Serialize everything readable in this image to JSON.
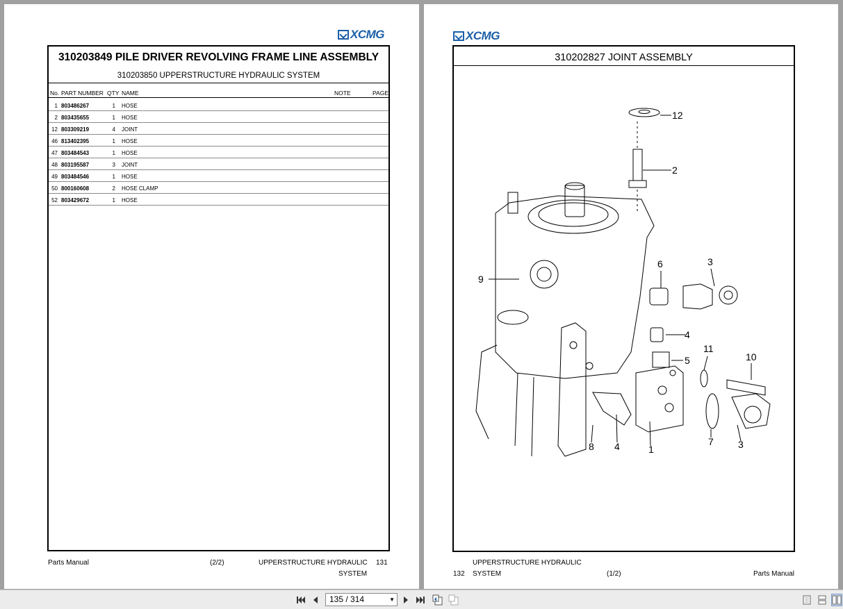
{
  "brand": "XCMG",
  "left_page": {
    "title": "310203849 PILE DRIVER REVOLVING FRAME LINE ASSEMBLY",
    "subtitle": "310203850 UPPERSTRUCTURE HYDRAULIC SYSTEM",
    "headers": {
      "no": "No.",
      "part_number": "PART NUMBER",
      "qty": "QTY",
      "name": "NAME",
      "note": "NOTE",
      "page": "PAGE"
    },
    "rows": [
      {
        "no": "1",
        "part_number": "803486267",
        "qty": "1",
        "name": "HOSE"
      },
      {
        "no": "2",
        "part_number": "803435655",
        "qty": "1",
        "name": "HOSE"
      },
      {
        "no": "12",
        "part_number": "803309219",
        "qty": "4",
        "name": "JOINT"
      },
      {
        "no": "46",
        "part_number": "813402395",
        "qty": "1",
        "name": "HOSE"
      },
      {
        "no": "47",
        "part_number": "803484543",
        "qty": "1",
        "name": "HOSE"
      },
      {
        "no": "48",
        "part_number": "803195587",
        "qty": "3",
        "name": "JOINT"
      },
      {
        "no": "49",
        "part_number": "803484546",
        "qty": "1",
        "name": "HOSE"
      },
      {
        "no": "50",
        "part_number": "800160608",
        "qty": "2",
        "name": "HOSE CLAMP"
      },
      {
        "no": "52",
        "part_number": "803429672",
        "qty": "1",
        "name": "HOSE"
      }
    ],
    "footer": {
      "manual": "Parts Manual",
      "part": "(2/2)",
      "section_line1": "UPPERSTRUCTURE HYDRAULIC",
      "section_line2": "SYSTEM",
      "page_number": "131"
    }
  },
  "right_page": {
    "title": "310202827 JOINT ASSEMBLY",
    "callouts": [
      "12",
      "2",
      "6",
      "3",
      "9",
      "4",
      "11",
      "10",
      "5",
      "7",
      "3",
      "8",
      "4",
      "1"
    ],
    "footer": {
      "page_number": "132",
      "section_line1": "UPPERSTRUCTURE HYDRAULIC",
      "section_line2": "SYSTEM",
      "part": "(1/2)",
      "manual": "Parts Manual"
    }
  },
  "toolbar": {
    "page_display": "135 / 314",
    "icons": [
      "first-page-icon",
      "prev-page-icon",
      "next-page-icon",
      "last-page-icon",
      "previous-view-icon",
      "next-view-icon",
      "single-page-icon",
      "continuous-icon",
      "two-page-icon"
    ]
  }
}
